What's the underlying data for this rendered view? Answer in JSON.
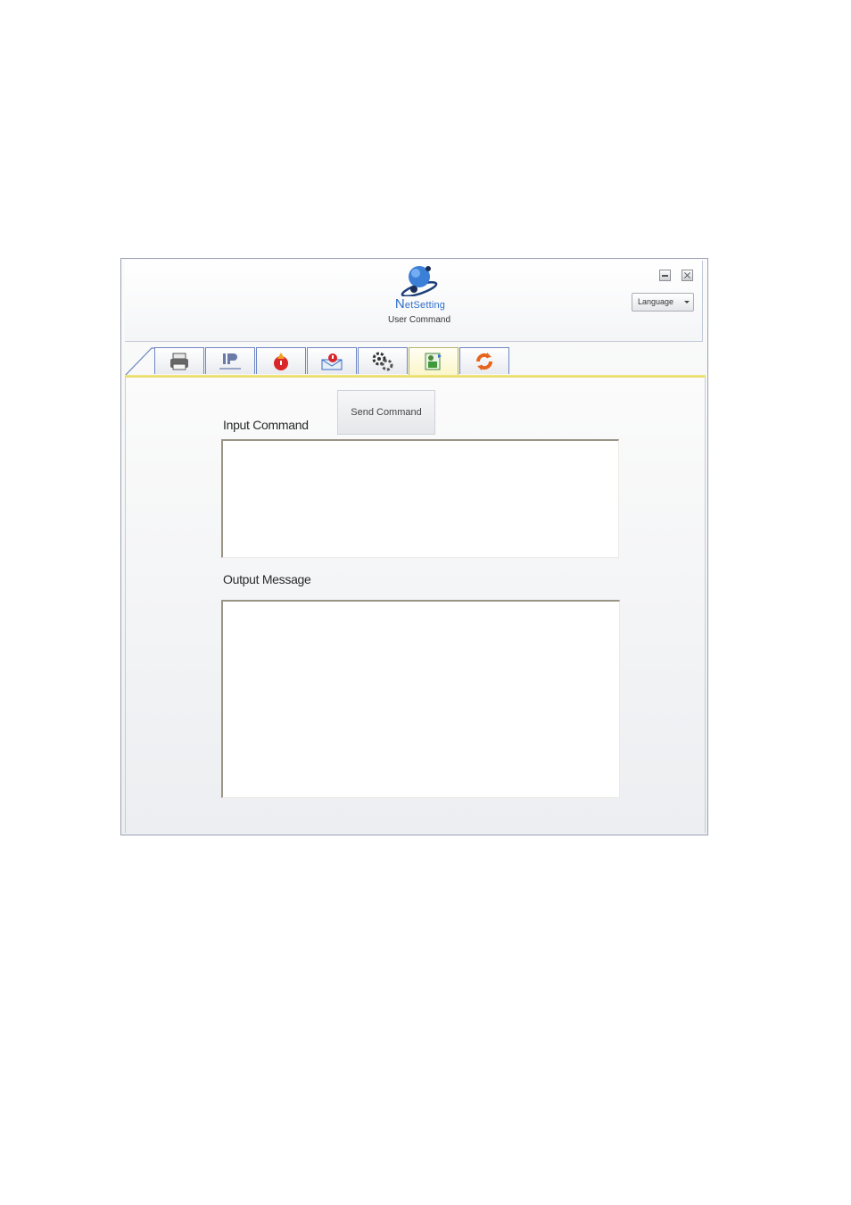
{
  "app": {
    "name_initial": "N",
    "name_rest": "etSetting",
    "subtitle": "User Command"
  },
  "header": {
    "language_label": "Language"
  },
  "tabs": [
    {
      "icon": "printer-icon",
      "active": false
    },
    {
      "icon": "ip-network-icon",
      "active": false
    },
    {
      "icon": "alert-icon",
      "active": false
    },
    {
      "icon": "email-alert-icon",
      "active": false
    },
    {
      "icon": "settings-gears-icon",
      "active": false
    },
    {
      "icon": "user-command-icon",
      "active": true
    },
    {
      "icon": "refresh-icon",
      "active": false
    }
  ],
  "main": {
    "input_label": "Input Command",
    "send_button_label": "Send Command",
    "input_value": "",
    "output_label": "Output Message",
    "output_value": ""
  },
  "colors": {
    "accent_blue": "#2f6fc9",
    "active_tab_underline": "#e6d95c",
    "tab_border": "#6d86c4"
  }
}
